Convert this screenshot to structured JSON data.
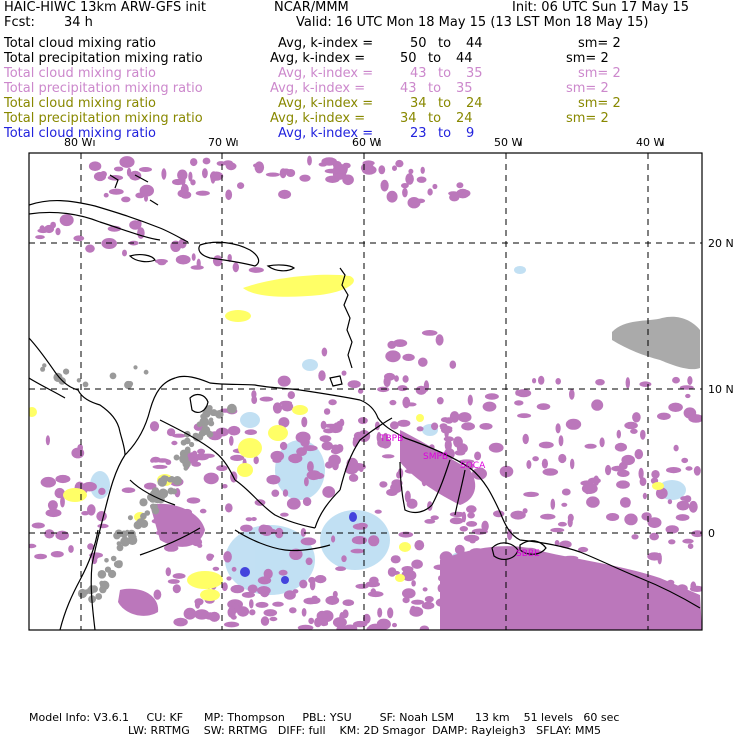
{
  "header": {
    "title": "HAIC-HIWC 13km ARW-GFS init",
    "org": "NCAR/MMM",
    "init": "Init: 06 UTC Sun 17 May 15",
    "fcst_label": "Fcst:",
    "fcst_value": "34 h",
    "valid": "Valid: 16 UTC Mon 18 May 15 (13 LST Mon 18 May 15)"
  },
  "fields": [
    {
      "name": "Total cloud mixing ratio",
      "avg": "Avg, k-index =",
      "range_from": "50",
      "to": "to",
      "range_to": "44",
      "sm": "sm= 2",
      "color": "#000000"
    },
    {
      "name": "Total precipitation mixing ratio",
      "avg": "Avg, k-index =",
      "range_from": "50",
      "to": "to",
      "range_to": "44",
      "sm": "sm= 2",
      "color": "#000000"
    },
    {
      "name": "Total cloud mixing ratio",
      "avg": "Avg, k-index =",
      "range_from": "43",
      "to": "to",
      "range_to": "35",
      "sm": "sm= 2",
      "color": "#cc88cc"
    },
    {
      "name": "Total precipitation mixing ratio",
      "avg": "Avg, k-index =",
      "range_from": "43",
      "to": "to",
      "range_to": "35",
      "sm": "sm= 2",
      "color": "#cc88cc"
    },
    {
      "name": "Total cloud mixing ratio",
      "avg": "Avg, k-index =",
      "range_from": "34",
      "to": "to",
      "range_to": "24",
      "sm": "sm= 2",
      "color": "#888800"
    },
    {
      "name": "Total precipitation mixing ratio",
      "avg": "Avg, k-index =",
      "range_from": "34",
      "to": "to",
      "range_to": "24",
      "sm": "sm= 2",
      "color": "#888800"
    },
    {
      "name": "Total cloud mixing ratio",
      "avg": "Avg, k-index =",
      "range_from": "23",
      "to": "to",
      "range_to": "9",
      "sm": "",
      "color": "#2222dd"
    }
  ],
  "map": {
    "lon_labels": [
      "80 W",
      "70 W",
      "60 W",
      "50 W",
      "40 W"
    ],
    "lat_labels": [
      "20 N",
      "10 N",
      "0"
    ],
    "stations": [
      "TBPB",
      "SMPB",
      "SOCA",
      "SBBE"
    ],
    "colors": {
      "layer_high": "#aaaaaa",
      "layer_mid_high": "#bb77bb",
      "layer_mid_low": "#ffff66",
      "layer_low": "#bbddf2",
      "layer_low_core": "#4444dd",
      "station_text": "#dd00dd",
      "grid": "#000000"
    }
  },
  "footer": {
    "line1": "Model Info: V3.6.1     CU: KF      MP: Thompson     PBL: YSU        SF: Noah LSM      13 km    51 levels   60 sec",
    "line2": "LW: RRTMG    SW: RRTMG   DIFF: full    KM: 2D Smagor  DAMP: Rayleigh3   SFLAY: MM5"
  }
}
